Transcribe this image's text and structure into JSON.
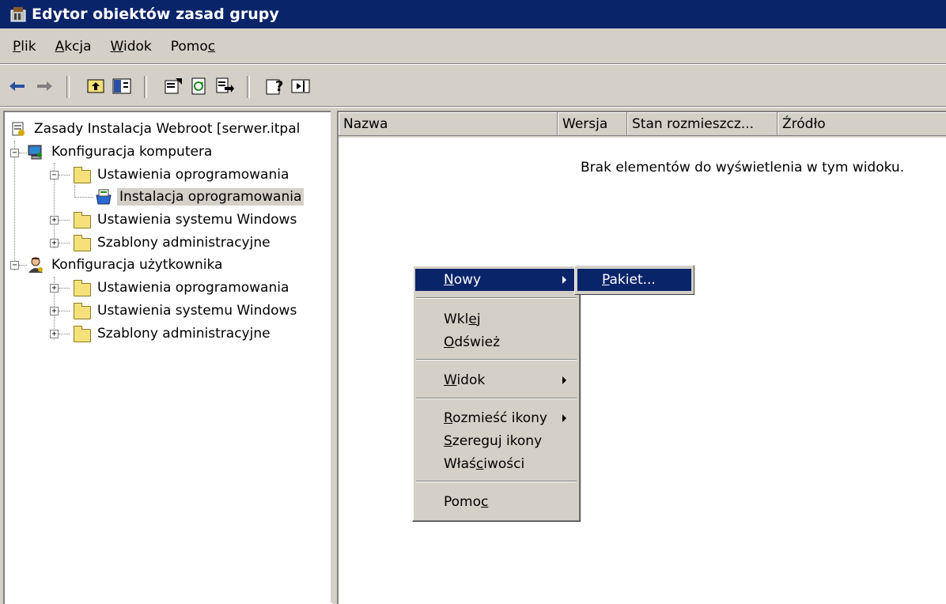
{
  "window": {
    "title": "Edytor obiektów zasad grupy",
    "title_icon": "gpo-editor-icon"
  },
  "menubar": {
    "items": [
      {
        "pre": "",
        "key": "P",
        "post": "lik"
      },
      {
        "pre": "",
        "key": "A",
        "post": "kcja"
      },
      {
        "pre": "",
        "key": "W",
        "post": "idok"
      },
      {
        "pre": "Pomo",
        "key": "c",
        "post": ""
      }
    ]
  },
  "toolbar": {
    "icons": [
      "back-icon",
      "forward-icon",
      "up-one-level-icon",
      "show-hide-tree-icon",
      "properties-icon",
      "refresh-icon",
      "export-list-icon",
      "help-icon",
      "action-pane-icon"
    ]
  },
  "tree": {
    "root": "Zasady Instalacja Webroot [serwer.itpal",
    "computer_config": "Konfiguracja komputera",
    "computer_software_settings": "Ustawienia oprogramowania",
    "software_installation": "Instalacja oprogramowania",
    "computer_windows_settings": "Ustawienia systemu Windows",
    "computer_admin_templates": "Szablony administracyjne",
    "user_config": "Konfiguracja użytkownika",
    "user_software_settings": "Ustawienia oprogramowania",
    "user_windows_settings": "Ustawienia systemu Windows",
    "user_admin_templates": "Szablony administracyjne",
    "expand_minus": "−",
    "expand_plus": "+"
  },
  "list": {
    "columns": [
      "Nazwa",
      "Wersja",
      "Stan rozmieszcz...",
      "Źródło"
    ],
    "empty_message": "Brak elementów do wyświetlenia w tym widoku."
  },
  "context_menu": {
    "new": {
      "pre": "",
      "key": "N",
      "post": "owy"
    },
    "paste": {
      "pre": "Wkl",
      "key": "e",
      "post": "j"
    },
    "refresh": {
      "pre": "",
      "key": "O",
      "post": "dśwież"
    },
    "view": {
      "pre": "",
      "key": "W",
      "post": "idok"
    },
    "arrange": {
      "pre": "",
      "key": "R",
      "post": "ozmieść ikony"
    },
    "line_up": {
      "pre": "",
      "key": "S",
      "post": "zereguj ikony"
    },
    "properties": {
      "pre": "Właś",
      "key": "c",
      "post": "iwości"
    },
    "help": {
      "pre": "Pomo",
      "key": "c",
      "post": ""
    }
  },
  "submenu": {
    "package": {
      "pre": "",
      "key": "P",
      "post": "akiet..."
    }
  }
}
